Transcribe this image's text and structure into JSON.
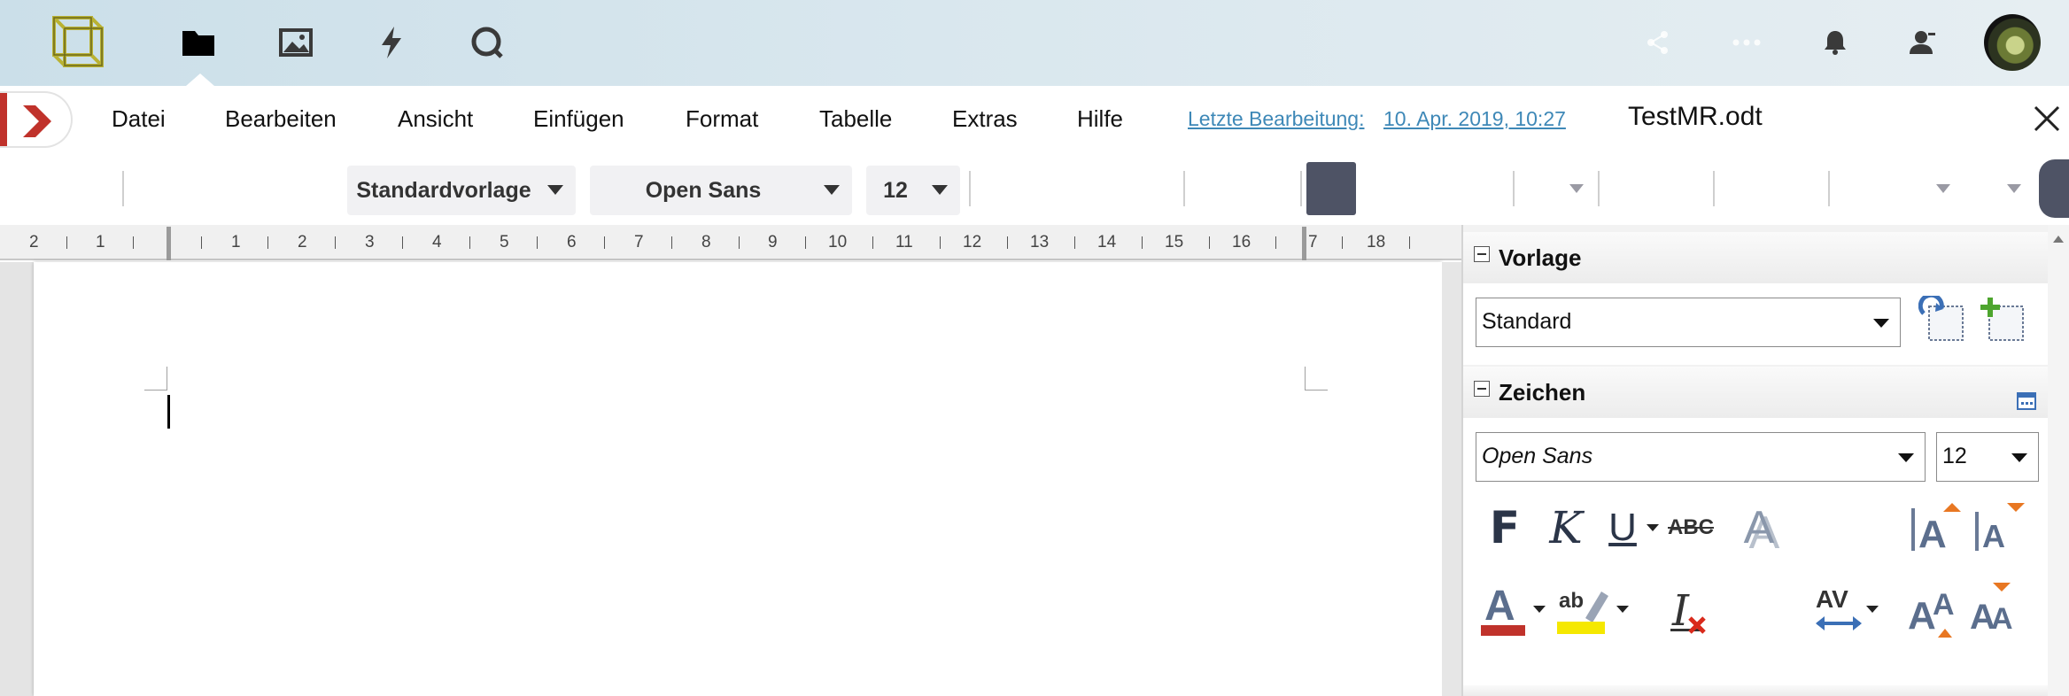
{
  "topbar": {
    "apps": [
      {
        "name": "files"
      },
      {
        "name": "photos"
      },
      {
        "name": "activity"
      },
      {
        "name": "talk"
      }
    ]
  },
  "menu": {
    "items": [
      "Datei",
      "Bearbeiten",
      "Ansicht",
      "Einfügen",
      "Format",
      "Tabelle",
      "Extras",
      "Hilfe"
    ],
    "last_edit_label": "Letzte Bearbeitung:",
    "last_edit_date": "10. Apr. 2019, 10:27",
    "filename": "TestMR.odt"
  },
  "toolbar": {
    "style_select": "Standardvorlage",
    "font_select": "Open Sans",
    "size_select": "12",
    "font_color": "#4e5365"
  },
  "ruler": {
    "left_marks": [
      "2",
      "1"
    ],
    "marks": [
      "1",
      "2",
      "3",
      "4",
      "5",
      "6",
      "7",
      "8",
      "9",
      "10",
      "11",
      "12",
      "13",
      "14",
      "15",
      "16",
      "7",
      "18"
    ]
  },
  "sidebar": {
    "vorlage": {
      "title": "Vorlage",
      "value": "Standard"
    },
    "zeichen": {
      "title": "Zeichen",
      "font": "Open Sans",
      "size": "12",
      "bold_glyph": "F",
      "italic_glyph": "K",
      "underline_glyph": "U",
      "strike_glyph": "ABC",
      "shadow_glyph": "A",
      "grow_glyph": "A",
      "shrink_glyph": "A",
      "fontcolor_glyph": "A",
      "highlight_glyph": "ab",
      "clear_glyph": "I",
      "spacing_glyph": "AV",
      "upper_glyph": "A",
      "lower_glyph": "A"
    }
  }
}
